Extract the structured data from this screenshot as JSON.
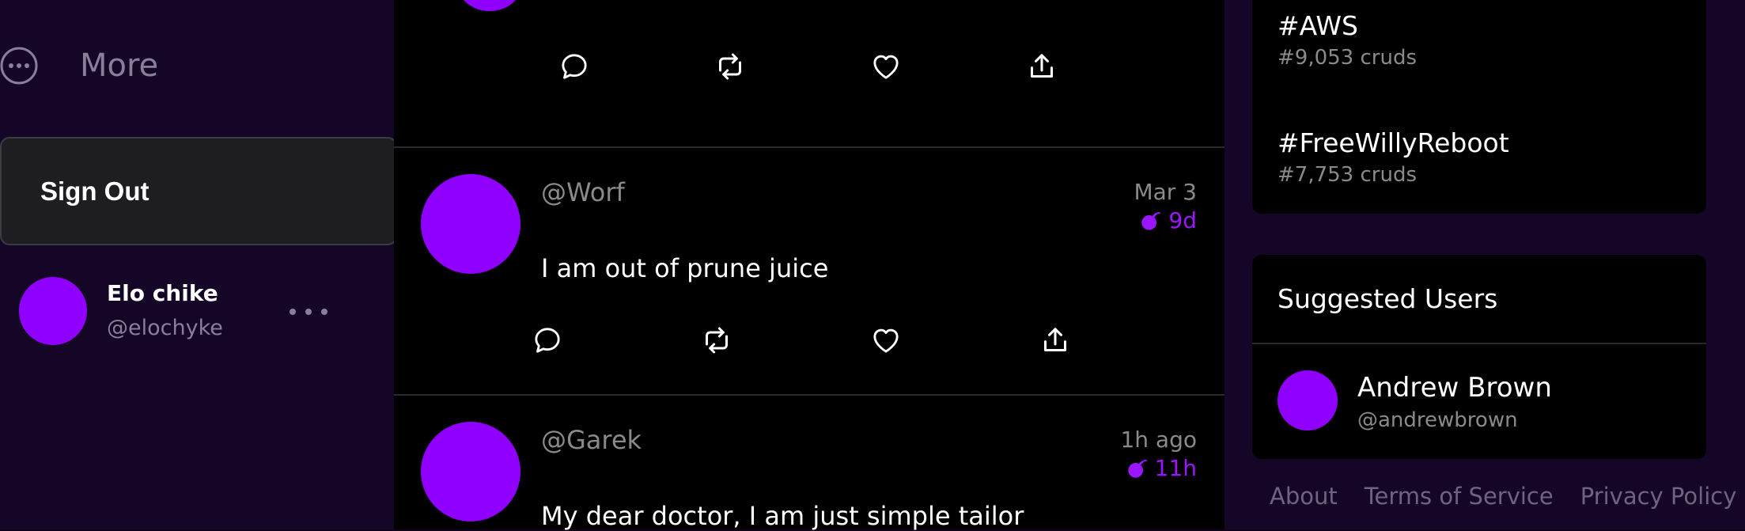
{
  "nav": {
    "more_label": "More"
  },
  "menu": {
    "sign_out_label": "Sign Out"
  },
  "profile": {
    "display_name": "Elo chike",
    "handle": "@elochyke"
  },
  "feed": {
    "cruds": [
      {
        "handle": "@Worf",
        "date": "Mar 3",
        "expires": "9d",
        "message": "I am out of prune juice"
      },
      {
        "handle": "@Garek",
        "date": "1h ago",
        "expires": "11h",
        "message": "My dear doctor, I am just simple tailor"
      }
    ]
  },
  "trending": {
    "items": [
      {
        "tag": "#AWS",
        "count": "#9,053 cruds"
      },
      {
        "tag": "#FreeWillyReboot",
        "count": "#7,753 cruds"
      }
    ]
  },
  "suggested": {
    "title": "Suggested Users",
    "users": [
      {
        "name": "Andrew Brown",
        "handle": "@andrewbrown"
      }
    ]
  },
  "footer": {
    "links": [
      "About",
      "Terms of Service",
      "Privacy Policy"
    ]
  },
  "colors": {
    "accent": "#9000ff",
    "expiry": "#9a16ff",
    "sidebar_bg": "#150527",
    "feed_bg": "#000000",
    "muted_text": "#8a7f98"
  },
  "icons": [
    "more-icon",
    "reply-icon",
    "repost-icon",
    "like-icon",
    "share-icon",
    "bomb-icon"
  ]
}
